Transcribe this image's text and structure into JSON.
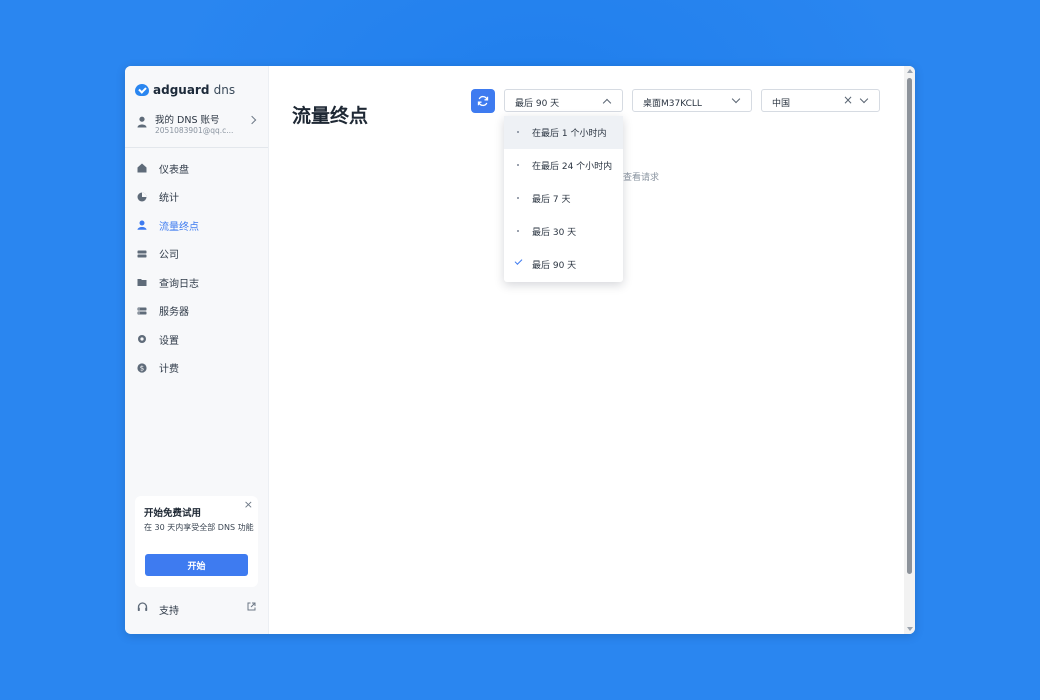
{
  "brand": {
    "name": "adguard",
    "suffix": "dns",
    "color": "#2a86f0"
  },
  "account": {
    "label": "我的 DNS 账号",
    "email": "2051083901@qq.c..."
  },
  "sidebar": {
    "items": [
      {
        "label": "仪表盘",
        "icon": "home-icon"
      },
      {
        "label": "统计",
        "icon": "pie-chart-icon"
      },
      {
        "label": "流量终点",
        "icon": "person-icon",
        "active": true
      },
      {
        "label": "公司",
        "icon": "server-icon"
      },
      {
        "label": "查询日志",
        "icon": "folder-icon"
      },
      {
        "label": "服务器",
        "icon": "servers-icon"
      },
      {
        "label": "设置",
        "icon": "gear-icon"
      },
      {
        "label": "计费",
        "icon": "dollar-icon"
      }
    ],
    "active_color": "#3e7bf0"
  },
  "trial": {
    "title": "开始免费试用",
    "description": "在 30 天内享受全部 DNS 功能",
    "button": "开始"
  },
  "support": {
    "label": "支持"
  },
  "main": {
    "title": "流量终点",
    "empty_text": "查看请求"
  },
  "filters": {
    "period": "最后 90 天",
    "device": "桌面M37KCLL",
    "country": "中国"
  },
  "period_options": [
    {
      "label": "在最后 1 个小时内",
      "hovered": true
    },
    {
      "label": "在最后 24 个小时内"
    },
    {
      "label": "最后 7 天"
    },
    {
      "label": "最后 30 天"
    },
    {
      "label": "最后 90 天",
      "selected": true
    }
  ],
  "accent": "#3e7bf0"
}
